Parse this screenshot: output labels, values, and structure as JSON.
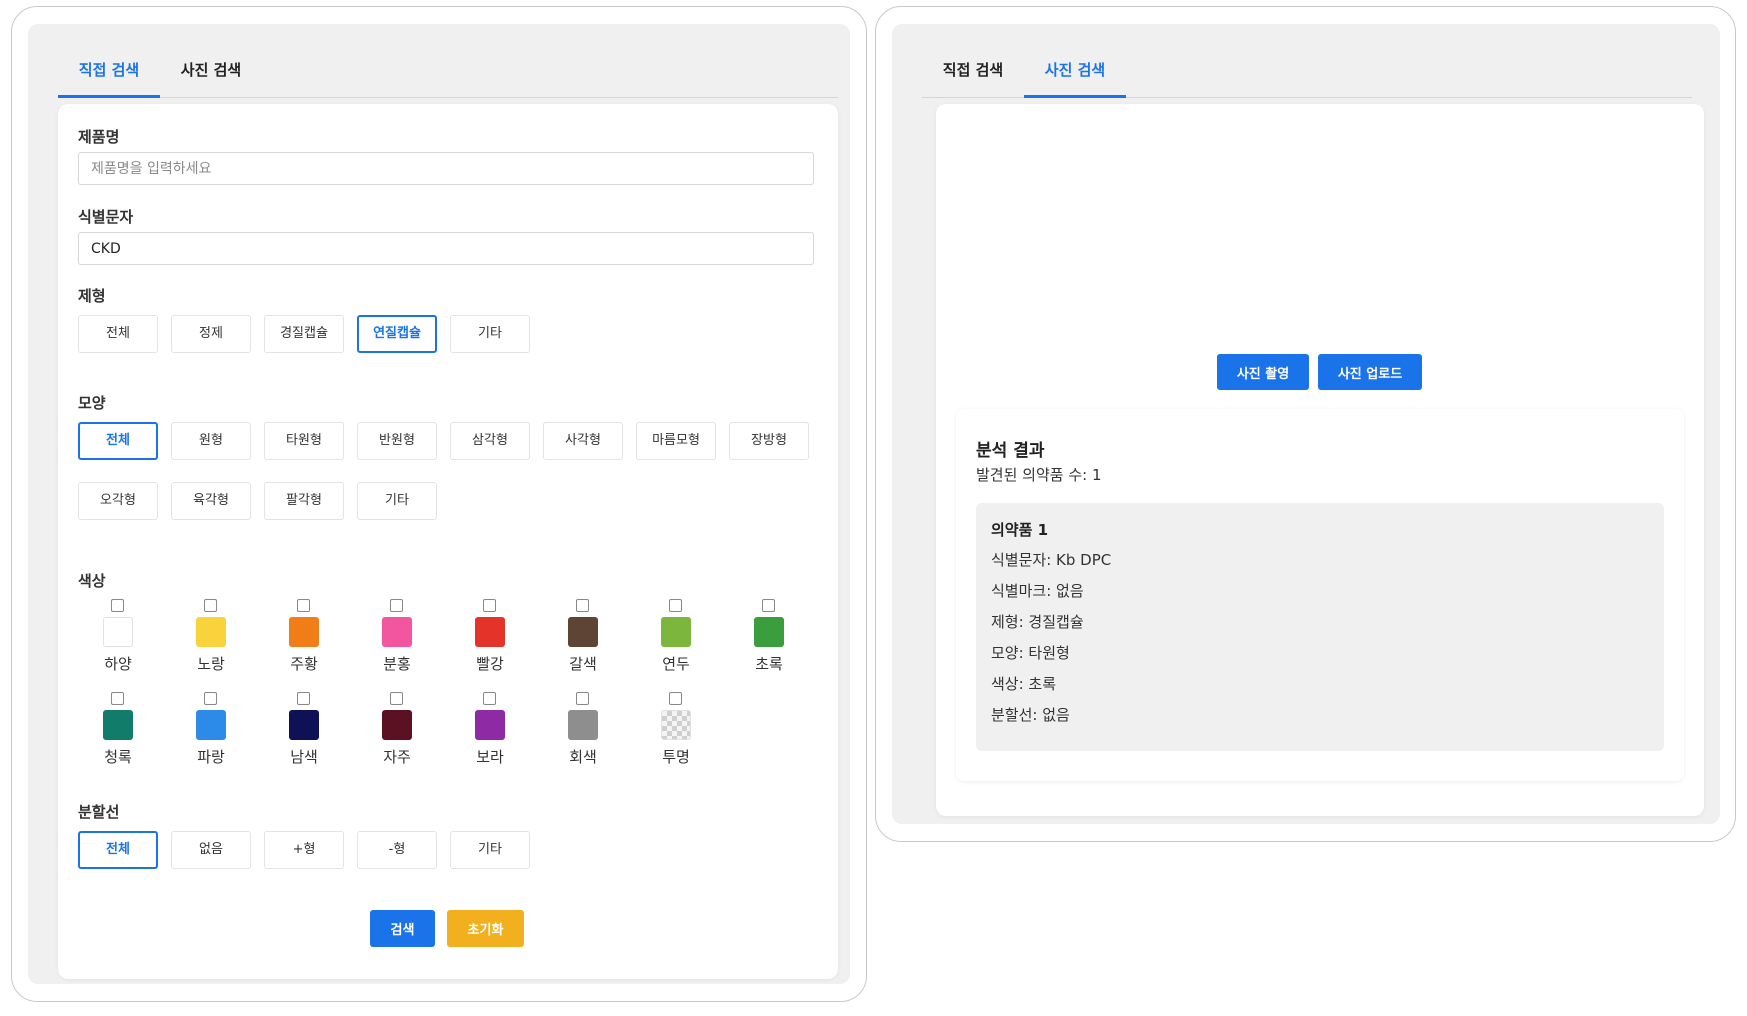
{
  "left": {
    "tabs": [
      {
        "label": "직접 검색",
        "active": true
      },
      {
        "label": "사진 검색",
        "active": false
      }
    ],
    "product_name": {
      "label": "제품명",
      "placeholder": "제품명을 입력하세요",
      "value": ""
    },
    "identifier": {
      "label": "식별문자",
      "value": "CKD"
    },
    "dosage_form": {
      "label": "제형",
      "options": [
        "전체",
        "정제",
        "경질캡슐",
        "연질캡슐",
        "기타"
      ],
      "selected": "연질캡슐"
    },
    "shape": {
      "label": "모양",
      "options": [
        "전체",
        "원형",
        "타원형",
        "반원형",
        "삼각형",
        "사각형",
        "마름모형",
        "장방형",
        "오각형",
        "육각형",
        "팔각형",
        "기타"
      ],
      "selected": "전체"
    },
    "color": {
      "label": "색상",
      "options": [
        {
          "name": "하양",
          "hex": "#ffffff"
        },
        {
          "name": "노랑",
          "hex": "#f9d33b"
        },
        {
          "name": "주황",
          "hex": "#f07d17"
        },
        {
          "name": "분홍",
          "hex": "#f2569f"
        },
        {
          "name": "빨강",
          "hex": "#e43328"
        },
        {
          "name": "갈색",
          "hex": "#5d4434"
        },
        {
          "name": "연두",
          "hex": "#7cb63d"
        },
        {
          "name": "초록",
          "hex": "#3a9d3e"
        },
        {
          "name": "청록",
          "hex": "#127c6a"
        },
        {
          "name": "파랑",
          "hex": "#2c8be8"
        },
        {
          "name": "남색",
          "hex": "#0f1157"
        },
        {
          "name": "자주",
          "hex": "#5b1122"
        },
        {
          "name": "보라",
          "hex": "#8e2aa4"
        },
        {
          "name": "회색",
          "hex": "#8e8e8e"
        },
        {
          "name": "투명",
          "hex": "checker"
        }
      ]
    },
    "score_line": {
      "label": "분할선",
      "options": [
        "전체",
        "없음",
        "+형",
        "-형",
        "기타"
      ],
      "selected": "전체"
    },
    "buttons": {
      "search": "검색",
      "reset": "초기화"
    }
  },
  "right": {
    "tabs": [
      {
        "label": "직접 검색",
        "active": false
      },
      {
        "label": "사진 검색",
        "active": true
      }
    ],
    "buttons": {
      "capture": "사진 촬영",
      "upload": "사진 업로드"
    },
    "result": {
      "title": "분석 결과",
      "count_text": "발견된 의약품 수: 1",
      "drug": {
        "title": "의약품 1",
        "lines": [
          "식별문자: Kb DPC",
          "식별마크: 없음",
          "제형: 경질캡슐",
          "모양: 타원형",
          "색상: 초록",
          "분할선: 없음"
        ]
      }
    }
  },
  "accent_color": "#1a73e8",
  "reset_color": "#f2b01e"
}
